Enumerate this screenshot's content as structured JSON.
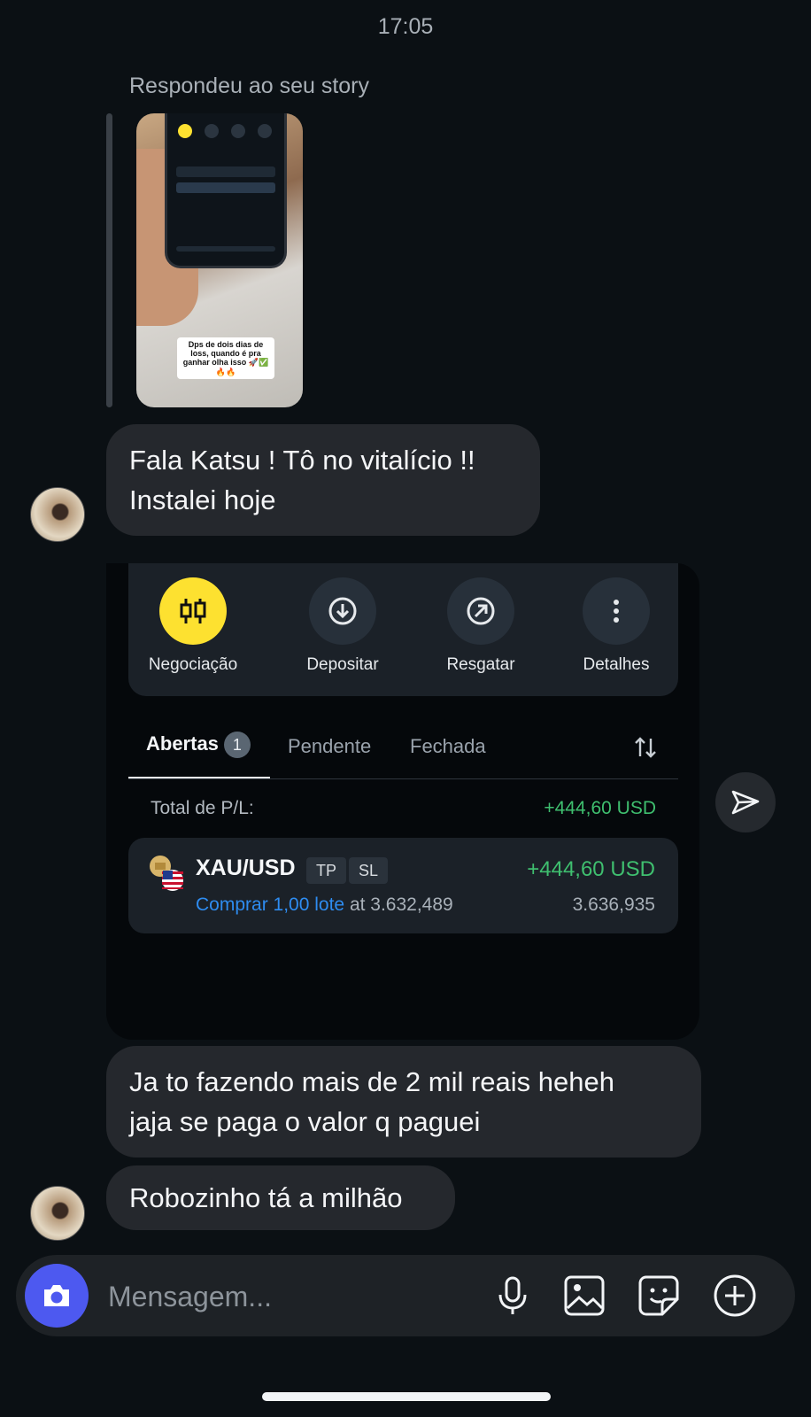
{
  "status": {
    "time": "17:05"
  },
  "story_reply": {
    "note": "Respondeu ao seu story",
    "caption": "Dps de dois dias de loss, quando é pra ganhar olha isso 🚀✅🔥🔥"
  },
  "messages": [
    {
      "text_line1": "Fala Katsu ! Tô no vitalício !!",
      "text_line2": "Instalei hoje"
    },
    {
      "text_line1": "Ja to fazendo mais de 2 mil reais heheh",
      "text_line2": "jaja se paga o valor q paguei"
    },
    {
      "text_line1": "Robozinho tá a milhão"
    }
  ],
  "trade_screenshot": {
    "actions": [
      {
        "label": "Negociação",
        "icon": "candlestick-icon"
      },
      {
        "label": "Depositar",
        "icon": "download-circle-icon"
      },
      {
        "label": "Resgatar",
        "icon": "arrow-up-right-circle-icon"
      },
      {
        "label": "Detalhes",
        "icon": "more-vertical-icon"
      }
    ],
    "tabs": [
      {
        "label": "Abertas",
        "badge": "1"
      },
      {
        "label": "Pendente"
      },
      {
        "label": "Fechada"
      }
    ],
    "total_label": "Total de P/L:",
    "total_value": "+444,60 USD",
    "position": {
      "symbol": "XAU/USD",
      "chip_tp": "TP",
      "chip_sl": "SL",
      "pl": "+444,60 USD",
      "order": "Comprar 1,00 lote",
      "at_text": "at 3.632,489",
      "current_price": "3.636,935"
    }
  },
  "composer": {
    "placeholder": "Mensagem..."
  },
  "colors": {
    "background": "#0b1014",
    "bubble": "#25282d",
    "accent_yellow": "#fde130",
    "profit_green": "#3fbf6f",
    "link_blue": "#2e8cf0",
    "camera_button": "#4d59f0"
  }
}
